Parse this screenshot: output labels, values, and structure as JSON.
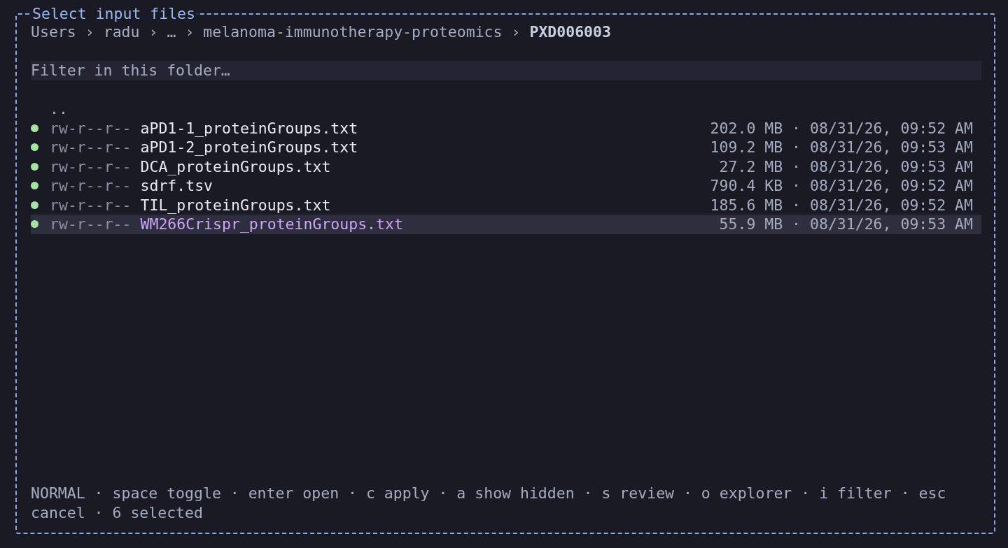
{
  "dialog": {
    "title": "Select input files"
  },
  "breadcrumb": {
    "separator": "›",
    "segments": [
      "Users",
      "radu",
      "…",
      "melanoma-immunotherapy-proteomics",
      "PXD006003"
    ]
  },
  "filter": {
    "placeholder": "Filter in this folder…"
  },
  "parent_entry": "..",
  "files": [
    {
      "checked": true,
      "selected": false,
      "permissions": "rw-r--r--",
      "name": "aPD1-1_proteinGroups.txt",
      "info": "202.0 MB · 08/31/26, 09:52 AM"
    },
    {
      "checked": true,
      "selected": false,
      "permissions": "rw-r--r--",
      "name": "aPD1-2_proteinGroups.txt",
      "info": "109.2 MB · 08/31/26, 09:53 AM"
    },
    {
      "checked": true,
      "selected": false,
      "permissions": "rw-r--r--",
      "name": "DCA_proteinGroups.txt",
      "info": "27.2 MB · 08/31/26, 09:53 AM"
    },
    {
      "checked": true,
      "selected": false,
      "permissions": "rw-r--r--",
      "name": "sdrf.tsv",
      "info": "790.4 KB · 08/31/26, 09:52 AM"
    },
    {
      "checked": true,
      "selected": false,
      "permissions": "rw-r--r--",
      "name": "TIL_proteinGroups.txt",
      "info": "185.6 MB · 08/31/26, 09:52 AM"
    },
    {
      "checked": true,
      "selected": true,
      "permissions": "rw-r--r--",
      "name": "WM266Crispr_proteinGroups.txt",
      "info": "55.9 MB · 08/31/26, 09:53 AM"
    }
  ],
  "status_bar": "NORMAL · space toggle · enter open · c apply · a show hidden · s review · o explorer · i filter · esc cancel · 6 selected"
}
